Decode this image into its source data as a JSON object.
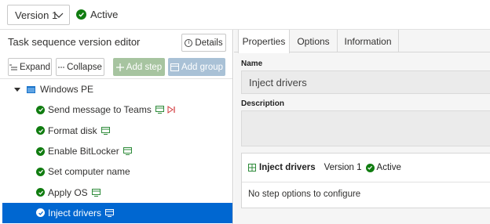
{
  "top": {
    "version_label": "Version 1",
    "status_label": "Active"
  },
  "left": {
    "title": "Task sequence version editor",
    "details_label": "Details",
    "toolbar": {
      "expand_label": "Expand",
      "collapse_label": "Collapse",
      "add_step_label": "Add step",
      "add_group_label": "Add group"
    },
    "tree": {
      "group_label": "Windows PE",
      "steps": [
        {
          "label": "Send message to Teams"
        },
        {
          "label": "Format disk"
        },
        {
          "label": "Enable BitLocker"
        },
        {
          "label": "Set computer name"
        },
        {
          "label": "Apply OS"
        },
        {
          "label": "Inject drivers",
          "selected": true
        }
      ]
    }
  },
  "right": {
    "tabs": [
      {
        "label": "Properties",
        "active": true
      },
      {
        "label": "Options"
      },
      {
        "label": "Information"
      }
    ],
    "name_label": "Name",
    "name_value": "Inject drivers",
    "description_label": "Description",
    "description_value": "",
    "card": {
      "step_name": "Inject drivers",
      "version": "Version 1",
      "status": "Active",
      "body_text": "No step options to configure"
    }
  },
  "colors": {
    "active_green": "#107c10",
    "selected_blue": "#0067d1",
    "add_step_bg": "#a7c4a0",
    "add_group_bg": "#a9c1d6"
  }
}
